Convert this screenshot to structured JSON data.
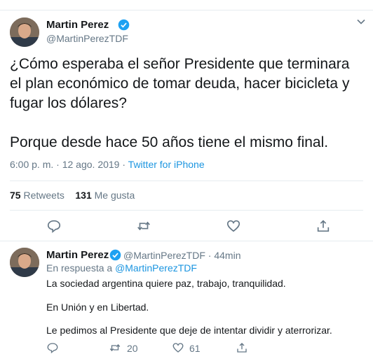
{
  "main_tweet": {
    "author_name": "Martin Perez",
    "author_handle": "@MartinPerezTDF",
    "text_p1": "¿Cómo esperaba el señor Presidente que terminara el plan económico de tomar deuda, hacer bicicleta y fugar los dólares?",
    "text_p2": "Porque desde hace 50 años tiene el mismo final.",
    "time": "6:00 p. m.",
    "sep": " · ",
    "date": "12 ago. 2019",
    "source": "Twitter for iPhone",
    "retweets_count": "75",
    "retweets_label": "Retweets",
    "likes_count": "131",
    "likes_label": "Me gusta"
  },
  "reply_tweet": {
    "author_name": "Martin Perez",
    "author_handle": "@MartinPerezTDF",
    "dot": "·",
    "age": "44min",
    "in_reply_prefix": "En respuesta a",
    "in_reply_handle": "@MartinPerezTDF",
    "line1": "La sociedad argentina quiere paz, trabajo, tranquilidad.",
    "line2": "En Unión y en Libertad.",
    "line3": "Le pedimos al Presidente que deje de intentar dividir y aterrorizar.",
    "retweets_count": "20",
    "likes_count": "61"
  },
  "colors": {
    "accent": "#1b95e0",
    "verified": "#1da1f2",
    "muted": "#657786",
    "text": "#14171a"
  },
  "icons": [
    "chevron-down-icon",
    "verified-icon",
    "reply-icon",
    "retweet-icon",
    "like-icon",
    "share-icon"
  ]
}
